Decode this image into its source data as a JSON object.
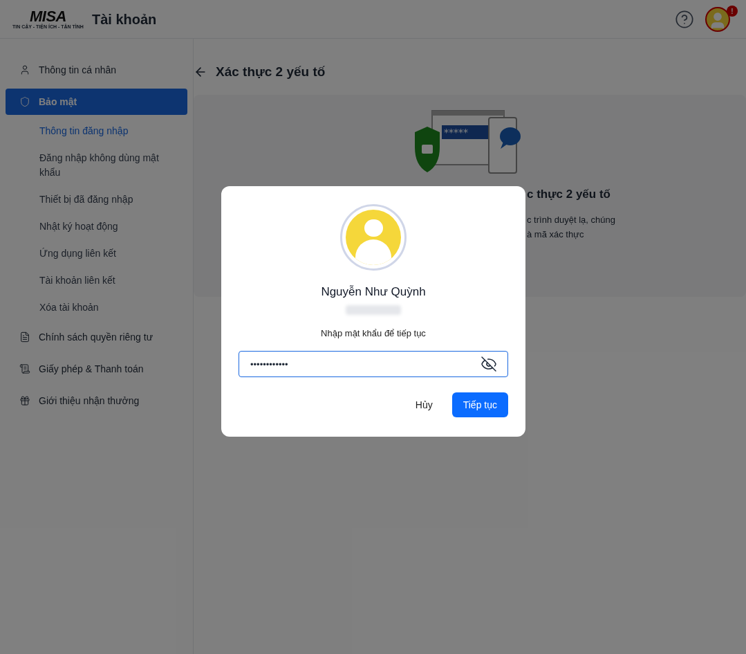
{
  "header": {
    "logo": "MISA",
    "logo_tagline": "TIN CẬY - TIỆN ÍCH - TẬN TÌNH",
    "title": "Tài khoản",
    "notification_badge": "!"
  },
  "sidebar": {
    "items": [
      {
        "kind": "person",
        "label": "Thông tin cá nhân",
        "selected": false
      },
      {
        "kind": "shield",
        "label": "Bảo mật",
        "selected": true,
        "children": [
          {
            "label": "Thông tin đăng nhập",
            "selected": true
          },
          {
            "label": "Đăng nhập không dùng mật khẩu",
            "selected": false
          },
          {
            "label": "Thiết bị đã đăng nhập",
            "selected": false
          },
          {
            "label": "Nhật ký hoạt động",
            "selected": false
          },
          {
            "label": "Ứng dụng liên kết",
            "selected": false
          },
          {
            "label": "Tài khoản liên kết",
            "selected": false
          },
          {
            "label": "Xóa tài khoản",
            "selected": false
          }
        ]
      },
      {
        "kind": "document",
        "label": "Chính sách quyền riêng tư",
        "selected": false
      },
      {
        "kind": "license",
        "label": "Giấy phép & Thanh toán",
        "selected": false
      },
      {
        "kind": "gift",
        "label": "Giới thiệu nhận thưởng",
        "selected": false
      }
    ]
  },
  "page": {
    "title": "Xác thực 2 yếu tố",
    "illustration_password": "*****",
    "card_heading_visible": "c thực 2 yếu tố",
    "card_text_visible": [
      "c trình duyệt lạ, chúng",
      "à mã xác thực"
    ]
  },
  "dialog": {
    "name": "Nguyễn Như Quỳnh",
    "prompt": "Nhập mật khẩu để tiếp tục",
    "password": "••••••••••••",
    "password_visible": false,
    "buttons": [
      {
        "kind": "cancel",
        "label": "Hủy"
      },
      {
        "kind": "primary",
        "label": "Tiếp tục"
      }
    ]
  }
}
